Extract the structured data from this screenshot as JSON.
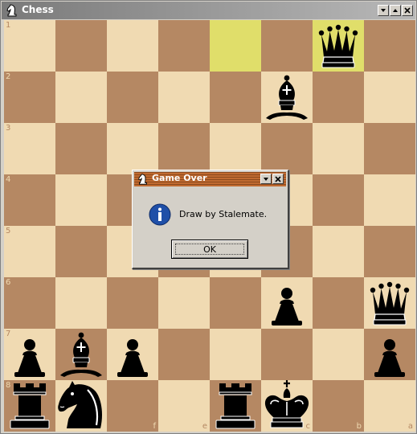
{
  "window": {
    "title": "Chess",
    "icon": "knight-icon",
    "buttons": [
      "minimize-button",
      "maximize-button",
      "close-button"
    ]
  },
  "board": {
    "colors": {
      "light": "#f0dab2",
      "dark": "#b58863",
      "highlight": "#e0de6a"
    },
    "rank_labels": [
      "1",
      "2",
      "3",
      "4",
      "5",
      "6",
      "7",
      "8"
    ],
    "file_labels": [
      "h",
      "g",
      "f",
      "e",
      "d",
      "c",
      "b",
      "a"
    ],
    "shown_file_labels": [
      "",
      "",
      "f",
      "e",
      "",
      "c",
      "b",
      "a"
    ],
    "highlighted_squares": [
      "d1",
      "b1"
    ],
    "pieces": [
      {
        "square": "b1",
        "piece": "queen",
        "color": "black"
      },
      {
        "square": "c2",
        "piece": "bishop",
        "color": "black"
      },
      {
        "square": "c6",
        "piece": "pawn",
        "color": "black"
      },
      {
        "square": "a6",
        "piece": "queen",
        "color": "black"
      },
      {
        "square": "h7",
        "piece": "pawn",
        "color": "black"
      },
      {
        "square": "g7",
        "piece": "bishop",
        "color": "black"
      },
      {
        "square": "f7",
        "piece": "pawn",
        "color": "black"
      },
      {
        "square": "a7",
        "piece": "pawn",
        "color": "black"
      },
      {
        "square": "h8",
        "piece": "rook",
        "color": "black"
      },
      {
        "square": "g8",
        "piece": "knight",
        "color": "black"
      },
      {
        "square": "d8",
        "piece": "rook",
        "color": "black"
      },
      {
        "square": "c8",
        "piece": "king",
        "color": "black"
      }
    ]
  },
  "dialog": {
    "title": "Game Over",
    "icon": "knight-icon",
    "message": "Draw by Stalemate.",
    "message_icon": "info-icon",
    "ok_label": "OK"
  }
}
